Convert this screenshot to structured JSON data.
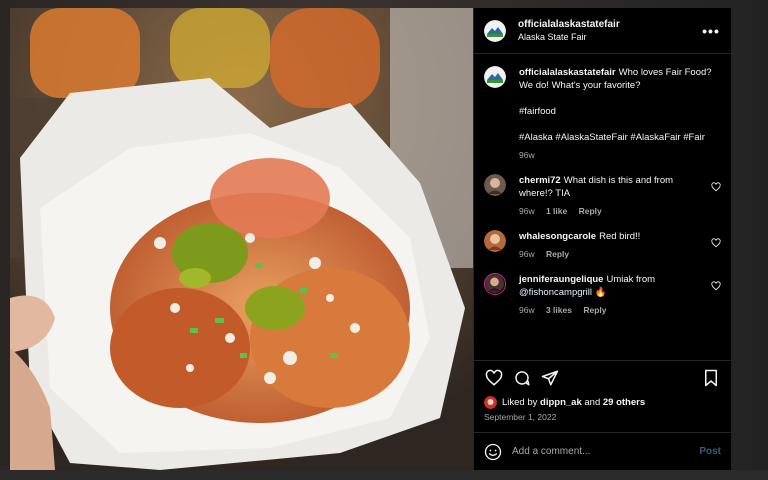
{
  "post": {
    "username": "officialalaskastatefair",
    "location": "Alaska State Fair",
    "more_icon": "more-horizontal-icon"
  },
  "caption": {
    "username": "officialalaskastatefair",
    "line1": "Who loves Fair Food? We do! What's your favorite?",
    "hashtag1": "#fairfood",
    "hashtags2": "#Alaska #AlaskaStateFair #AlaskaFair #Fair",
    "time": "96w"
  },
  "comments": [
    {
      "username": "chermi72",
      "text": "What dish is this and from where!? TIA",
      "time": "96w",
      "likes": "1 like",
      "reply": "Reply"
    },
    {
      "username": "whalesongcarole",
      "text": "Red bird!!",
      "time": "96w",
      "likes": "",
      "reply": "Reply"
    },
    {
      "username": "jenniferaungelique",
      "text_prefix": "Umiak from",
      "mention": "@fishoncampgrill",
      "emoji": "🔥",
      "time": "96w",
      "likes": "3 likes",
      "reply": "Reply"
    }
  ],
  "actions": {
    "like_icon": "heart-icon",
    "comment_icon": "comment-icon",
    "share_icon": "send-icon",
    "save_icon": "bookmark-icon"
  },
  "likes": {
    "prefix": "Liked by",
    "user": "dippn_ak",
    "mid": "and",
    "others": "29 others"
  },
  "date": "September 1, 2022",
  "composer": {
    "placeholder": "Add a comment...",
    "post_label": "Post"
  },
  "colors": {
    "background": "#000000",
    "text": "#f5f5f5",
    "secondary": "#a8a8a8",
    "post_disabled": "#3a5a7a"
  }
}
